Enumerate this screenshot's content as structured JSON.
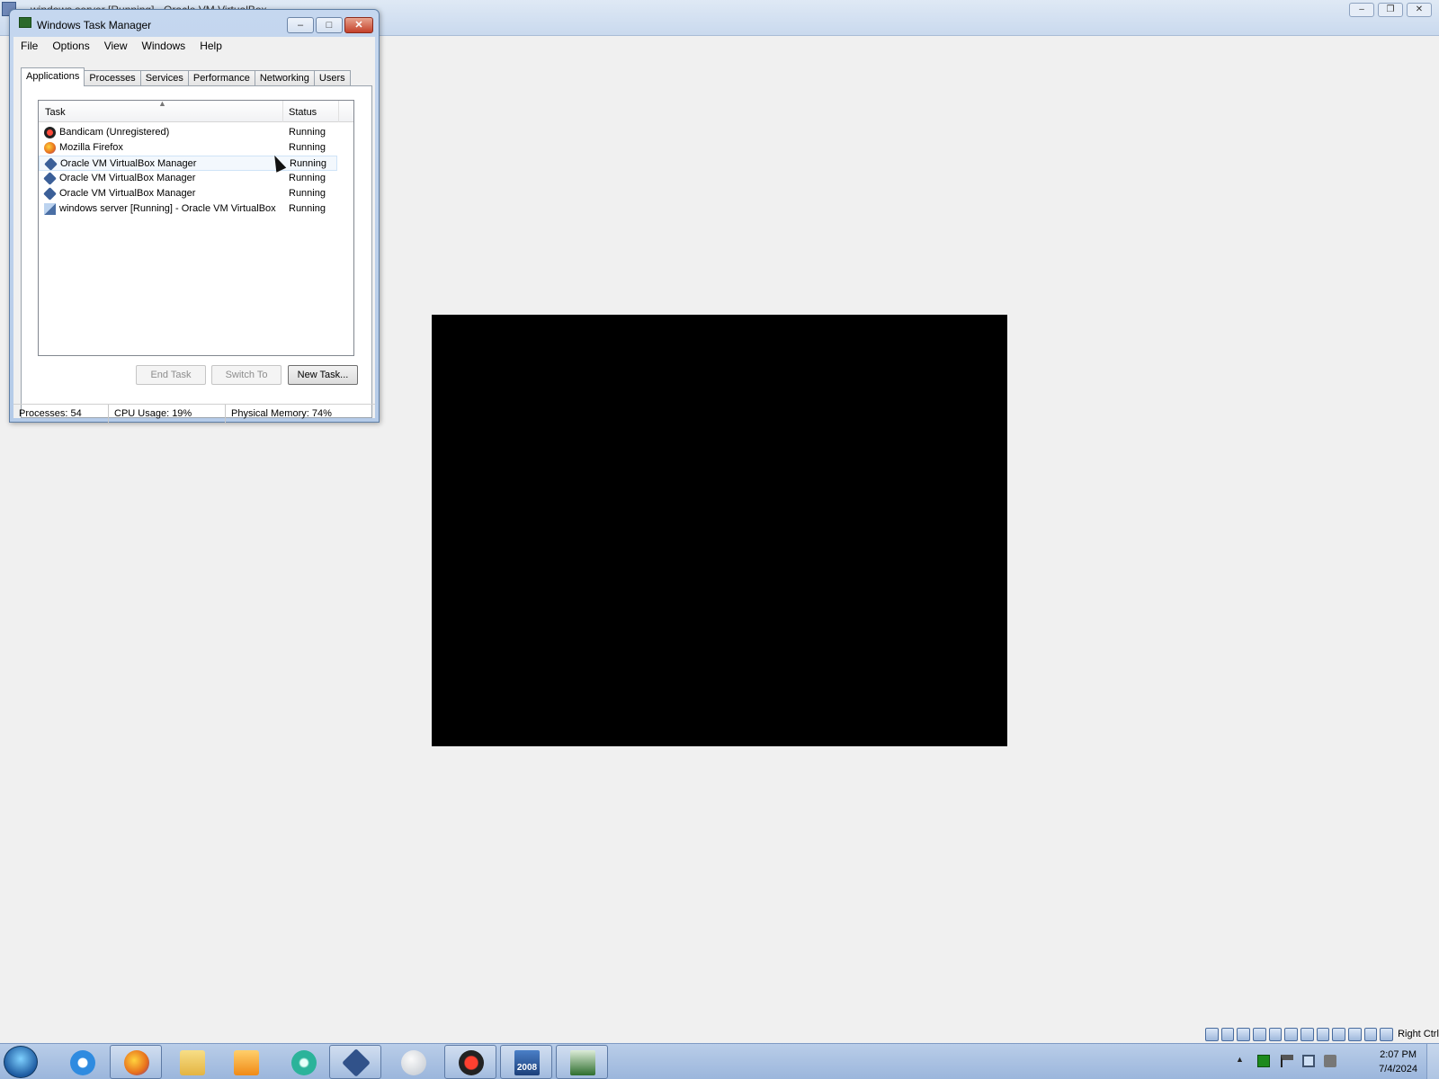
{
  "vbox_window": {
    "title": "windows server [Running] - Oracle VM VirtualBox",
    "minimize_label": "–",
    "restore_label": "❐",
    "close_label": "✕"
  },
  "task_manager": {
    "title": "Windows Task Manager",
    "window_buttons": {
      "minimize": "–",
      "maximize": "□",
      "close": "✕"
    },
    "menu": [
      "File",
      "Options",
      "View",
      "Windows",
      "Help"
    ],
    "tabs": [
      "Applications",
      "Processes",
      "Services",
      "Performance",
      "Networking",
      "Users"
    ],
    "active_tab": "Applications",
    "columns": {
      "task": "Task",
      "status": "Status"
    },
    "tasks": [
      {
        "name": "Bandicam (Unregistered)",
        "status": "Running",
        "icon": "bandicam-icon"
      },
      {
        "name": "Mozilla Firefox",
        "status": "Running",
        "icon": "firefox-icon"
      },
      {
        "name": "Oracle VM VirtualBox Manager",
        "status": "Running",
        "icon": "virtualbox-icon"
      },
      {
        "name": "Oracle VM VirtualBox Manager",
        "status": "Running",
        "icon": "virtualbox-icon"
      },
      {
        "name": "Oracle VM VirtualBox Manager",
        "status": "Running",
        "icon": "virtualbox-icon"
      },
      {
        "name": "windows server [Running] - Oracle VM VirtualBox",
        "status": "Running",
        "icon": "vm-window-icon"
      }
    ],
    "buttons": {
      "end_task": "End Task",
      "switch_to": "Switch To",
      "new_task": "New Task..."
    },
    "status_bar": {
      "processes": "Processes: 54",
      "cpu": "CPU Usage: 19%",
      "memory": "Physical Memory: 74%"
    }
  },
  "vm_status": {
    "host_key": "Right Ctrl"
  },
  "taskbar": {
    "clock_time": "2:07 PM",
    "clock_date": "7/4/2024",
    "badge_2008": "2008"
  },
  "colors": {
    "desktop_bg": "#f0f0f0",
    "guest_screen": "#000000",
    "taskbar": "#9bb6dc"
  }
}
